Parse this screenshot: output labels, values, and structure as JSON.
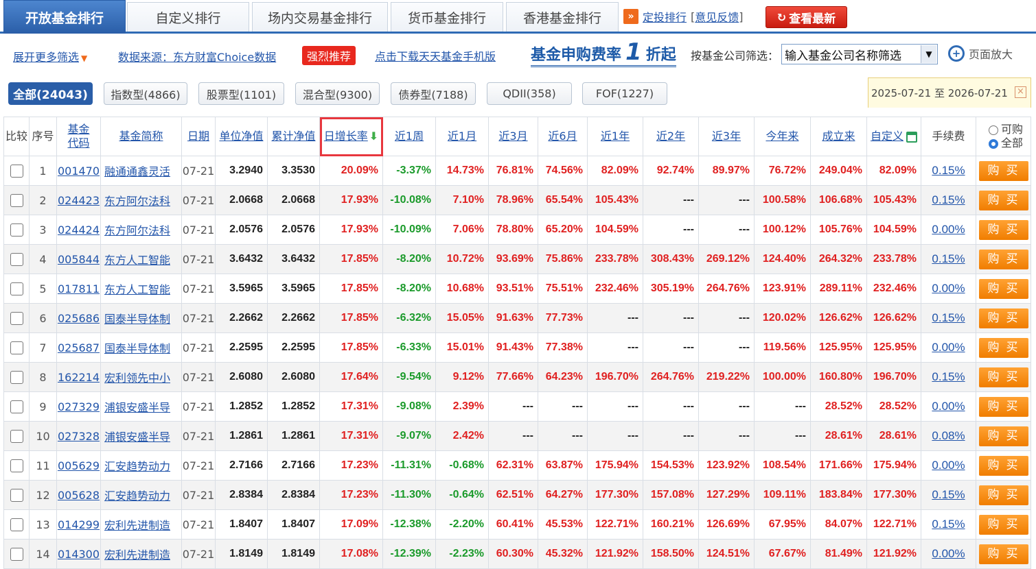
{
  "tabs": [
    "开放基金排行",
    "自定义排行",
    "场内交易基金排行",
    "货币基金排行",
    "香港基金排行"
  ],
  "toplinks": {
    "dingtou": "定投排行",
    "feedback": "意见反馈",
    "refresh": "查看最新",
    "dt_icon": "double-chevron-right-icon"
  },
  "bar2": {
    "more_filter": "展开更多筛选",
    "data_source": "数据来源：东方财富Choice数据",
    "hot": "强烈推荐",
    "download": "点击下载天天基金手机版",
    "promo_pre": "基金申购费率",
    "promo_num": "1",
    "promo_post": "折起",
    "company_label": "按基金公司筛选：",
    "company_placeholder": "输入基金公司名称筛选",
    "zoom": "页面放大"
  },
  "types": [
    "全部(24043)",
    "指数型(4866)",
    "股票型(1101)",
    "混合型(9300)",
    "债券型(7188)",
    "QDII(358)",
    "FOF(1227)"
  ],
  "date_range": "2025-07-21 至 2026-07-21",
  "header": {
    "compare": "比较",
    "index": "序号",
    "code": "基金代码",
    "name": "基金简称",
    "date": "日期",
    "nav": "单位净值",
    "acc": "累计净值",
    "daily": "日增长率",
    "w1": "近1周",
    "m1": "近1月",
    "m3": "近3月",
    "m6": "近6月",
    "y1": "近1年",
    "y2": "近2年",
    "y3": "近3年",
    "ytd": "今年来",
    "since": "成立来",
    "custom": "自定义",
    "fee": "手续费",
    "opt_buy": "可购",
    "opt_all": "全部"
  },
  "buy_label": "购买",
  "rows": [
    {
      "i": "1",
      "code": "001470",
      "name": "融通通鑫灵活",
      "date": "07-21",
      "nav": "3.2940",
      "acc": "3.3530",
      "r": [
        "20.09%",
        "-3.37%",
        "14.73%",
        "76.81%",
        "74.56%",
        "82.09%",
        "92.74%",
        "89.97%",
        "76.72%",
        "249.04%",
        "82.09%"
      ],
      "fee": "0.15%"
    },
    {
      "i": "2",
      "code": "024423",
      "name": "东方阿尔法科",
      "date": "07-21",
      "nav": "2.0668",
      "acc": "2.0668",
      "r": [
        "17.93%",
        "-10.08%",
        "7.10%",
        "78.96%",
        "65.54%",
        "105.43%",
        "---",
        "---",
        "100.58%",
        "106.68%",
        "105.43%"
      ],
      "fee": "0.15%"
    },
    {
      "i": "3",
      "code": "024424",
      "name": "东方阿尔法科",
      "date": "07-21",
      "nav": "2.0576",
      "acc": "2.0576",
      "r": [
        "17.93%",
        "-10.09%",
        "7.06%",
        "78.80%",
        "65.20%",
        "104.59%",
        "---",
        "---",
        "100.12%",
        "105.76%",
        "104.59%"
      ],
      "fee": "0.00%"
    },
    {
      "i": "4",
      "code": "005844",
      "name": "东方人工智能",
      "date": "07-21",
      "nav": "3.6432",
      "acc": "3.6432",
      "r": [
        "17.85%",
        "-8.20%",
        "10.72%",
        "93.69%",
        "75.86%",
        "233.78%",
        "308.43%",
        "269.12%",
        "124.40%",
        "264.32%",
        "233.78%"
      ],
      "fee": "0.15%"
    },
    {
      "i": "5",
      "code": "017811",
      "name": "东方人工智能",
      "date": "07-21",
      "nav": "3.5965",
      "acc": "3.5965",
      "r": [
        "17.85%",
        "-8.20%",
        "10.68%",
        "93.51%",
        "75.51%",
        "232.46%",
        "305.19%",
        "264.76%",
        "123.91%",
        "289.11%",
        "232.46%"
      ],
      "fee": "0.00%"
    },
    {
      "i": "6",
      "code": "025686",
      "name": "国泰半导体制",
      "date": "07-21",
      "nav": "2.2662",
      "acc": "2.2662",
      "r": [
        "17.85%",
        "-6.32%",
        "15.05%",
        "91.63%",
        "77.73%",
        "---",
        "---",
        "---",
        "120.02%",
        "126.62%",
        "126.62%"
      ],
      "fee": "0.15%"
    },
    {
      "i": "7",
      "code": "025687",
      "name": "国泰半导体制",
      "date": "07-21",
      "nav": "2.2595",
      "acc": "2.2595",
      "r": [
        "17.85%",
        "-6.33%",
        "15.01%",
        "91.43%",
        "77.38%",
        "---",
        "---",
        "---",
        "119.56%",
        "125.95%",
        "125.95%"
      ],
      "fee": "0.00%"
    },
    {
      "i": "8",
      "code": "162214",
      "name": "宏利领先中小",
      "date": "07-21",
      "nav": "2.6080",
      "acc": "2.6080",
      "r": [
        "17.64%",
        "-9.54%",
        "9.12%",
        "77.66%",
        "64.23%",
        "196.70%",
        "264.76%",
        "219.22%",
        "100.00%",
        "160.80%",
        "196.70%"
      ],
      "fee": "0.15%"
    },
    {
      "i": "9",
      "code": "027329",
      "name": "浦银安盛半导",
      "date": "07-21",
      "nav": "1.2852",
      "acc": "1.2852",
      "r": [
        "17.31%",
        "-9.08%",
        "2.39%",
        "---",
        "---",
        "---",
        "---",
        "---",
        "---",
        "28.52%",
        "28.52%"
      ],
      "fee": "0.00%"
    },
    {
      "i": "10",
      "code": "027328",
      "name": "浦银安盛半导",
      "date": "07-21",
      "nav": "1.2861",
      "acc": "1.2861",
      "r": [
        "17.31%",
        "-9.07%",
        "2.42%",
        "---",
        "---",
        "---",
        "---",
        "---",
        "---",
        "28.61%",
        "28.61%"
      ],
      "fee": "0.08%"
    },
    {
      "i": "11",
      "code": "005629",
      "name": "汇安趋势动力",
      "date": "07-21",
      "nav": "2.7166",
      "acc": "2.7166",
      "r": [
        "17.23%",
        "-11.31%",
        "-0.68%",
        "62.31%",
        "63.87%",
        "175.94%",
        "154.53%",
        "123.92%",
        "108.54%",
        "171.66%",
        "175.94%"
      ],
      "fee": "0.00%"
    },
    {
      "i": "12",
      "code": "005628",
      "name": "汇安趋势动力",
      "date": "07-21",
      "nav": "2.8384",
      "acc": "2.8384",
      "r": [
        "17.23%",
        "-11.30%",
        "-0.64%",
        "62.51%",
        "64.27%",
        "177.30%",
        "157.08%",
        "127.29%",
        "109.11%",
        "183.84%",
        "177.30%"
      ],
      "fee": "0.15%"
    },
    {
      "i": "13",
      "code": "014299",
      "name": "宏利先进制造",
      "date": "07-21",
      "nav": "1.8407",
      "acc": "1.8407",
      "r": [
        "17.09%",
        "-12.38%",
        "-2.20%",
        "60.41%",
        "45.53%",
        "122.71%",
        "160.21%",
        "126.69%",
        "67.95%",
        "84.07%",
        "122.71%"
      ],
      "fee": "0.15%"
    },
    {
      "i": "14",
      "code": "014300",
      "name": "宏利先进制造",
      "date": "07-21",
      "nav": "1.8149",
      "acc": "1.8149",
      "r": [
        "17.08%",
        "-12.39%",
        "-2.23%",
        "60.30%",
        "45.32%",
        "121.92%",
        "158.50%",
        "124.51%",
        "67.67%",
        "81.49%",
        "121.92%"
      ],
      "fee": "0.00%"
    }
  ],
  "colors": {
    "up": "#e02020",
    "down": "#1a9a2a",
    "accent": "#2a5ea8",
    "buy": "#f08a10",
    "sort_highlight": "#e8373e"
  }
}
